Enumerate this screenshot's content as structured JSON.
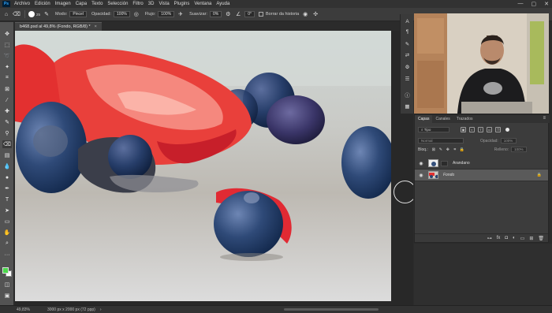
{
  "app": {
    "logo": "Ps"
  },
  "menu": [
    "Archivo",
    "Edición",
    "Imagen",
    "Capa",
    "Texto",
    "Selección",
    "Filtro",
    "3D",
    "Vista",
    "Plugins",
    "Ventana",
    "Ayuda"
  ],
  "window_controls": [
    "—",
    "▢",
    "✕"
  ],
  "options": {
    "brush_size": "25",
    "modo_label": "Modo:",
    "modo_value": "Pincel",
    "opacidad_label": "Opacidad:",
    "opacidad_value": "100%",
    "flujo_label": "Flujo:",
    "flujo_value": "100%",
    "suavizar_label": "Suavizar:",
    "suavizar_value": "0%",
    "angle_value": "0°",
    "borrar_historia_label": "Borrar da historia"
  },
  "document": {
    "tab_title": "b468.psd al 49,8% (Fondo, RGB/8) *",
    "tab_close": "×"
  },
  "status": {
    "zoom": "49,83%",
    "doc_info": "3000 px x 2000 px (72 ppp)",
    "arrow": "›"
  },
  "layers_panel": {
    "tabs": [
      "Capas",
      "Canales",
      "Trazados"
    ],
    "menu_icon": "≡",
    "filter_kind": "Tipo",
    "blend_mode": "Normal",
    "opacity_label": "Opacidad:",
    "opacity_value": "100%",
    "lock_label": "Bloq.:",
    "fill_label": "Relleno:",
    "fill_value": "100%",
    "layers": [
      {
        "name": "Arandano",
        "visible": true,
        "selected": false
      },
      {
        "name": "Fondo",
        "visible": true,
        "selected": true,
        "locked": true
      }
    ]
  },
  "colors": {
    "foreground": "#4cd84c",
    "background": "#ffffff",
    "ps_blue": "#31a8ff"
  }
}
